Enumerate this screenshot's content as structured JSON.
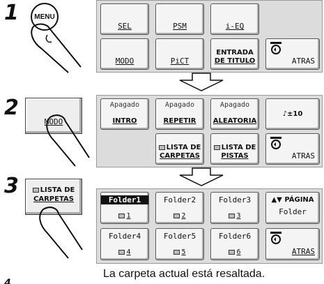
{
  "steps": [
    "1",
    "2",
    "3"
  ],
  "step1": {
    "hard_button": "MENU",
    "buttons": [
      "SEL",
      "PSM",
      "i-EQ",
      "MODO",
      "PiCT",
      "ENTRADA DE TITULO",
      "ATRAS"
    ],
    "entrada_l1": "ENTRADA",
    "entrada_l2": "DE TITULO"
  },
  "step2": {
    "side_button": "MODO",
    "apagado": "Apagado",
    "intro": "INTRO",
    "repetir": "REPETIR",
    "aleatoria": "ALEATORIA",
    "volume": "♪±10",
    "lista_carpetas_l1": "LISTA DE",
    "lista_carpetas_l2": "CARPETAS",
    "lista_pistas_l1": "LISTA DE",
    "lista_pistas_l2": "PISTAS",
    "atras": "ATRAS"
  },
  "step3": {
    "side_l1": "LISTA DE",
    "side_l2": "CARPETAS",
    "folders": [
      {
        "name": "Folder1",
        "num": "1"
      },
      {
        "name": "Folder2",
        "num": "2"
      },
      {
        "name": "Folder3",
        "num": "3"
      },
      {
        "name": "Folder4",
        "num": "4"
      },
      {
        "name": "Folder5",
        "num": "5"
      },
      {
        "name": "Folder6",
        "num": "6"
      }
    ],
    "pagina": "PÁGINA",
    "pagina_sub": "Folder",
    "atras": "ATRAS"
  },
  "caption": "La carpeta actual está resaltada.",
  "bottom_mark": "4"
}
